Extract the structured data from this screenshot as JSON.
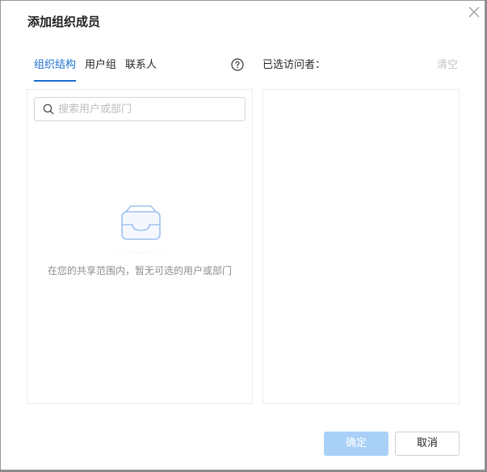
{
  "dialog": {
    "title": "添加组织成员"
  },
  "tabs": [
    {
      "label": "组织结构",
      "active": true
    },
    {
      "label": "用户组",
      "active": false
    },
    {
      "label": "联系人",
      "active": false
    }
  ],
  "help": {
    "icon": "question-circle-icon"
  },
  "selected": {
    "title": "已选访问者：",
    "clear_label": "清空"
  },
  "search": {
    "placeholder": "搜索用户或部门",
    "value": "",
    "icon": "search-icon"
  },
  "empty_state": {
    "icon": "empty-inbox-icon",
    "text": "在您的共享范围内，暂无可选的用户或部门"
  },
  "footer": {
    "confirm_label": "确定",
    "confirm_disabled": true,
    "cancel_label": "取消"
  },
  "colors": {
    "accent": "#1b6fd1",
    "confirm_disabled_bg": "#a9d0f7",
    "muted_text": "#8c8c8c"
  }
}
